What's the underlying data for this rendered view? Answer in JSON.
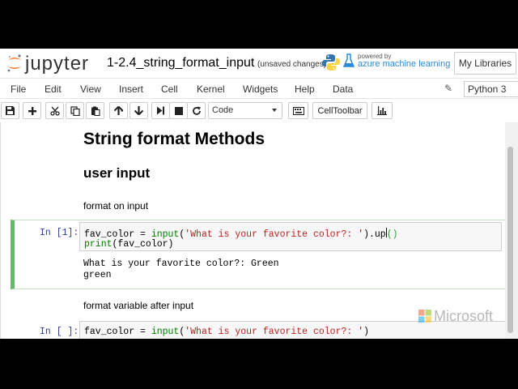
{
  "header": {
    "logo_text": "jupyter",
    "notebook_title": "1-2.4_string_format_input",
    "autosave_status": "(unsaved changes)",
    "powered_by": "powered by",
    "azure_ml": "azure machine learning",
    "my_libraries": "My Libraries"
  },
  "menu": {
    "items": [
      "File",
      "Edit",
      "View",
      "Insert",
      "Cell",
      "Kernel",
      "Widgets",
      "Help",
      "Data"
    ],
    "kernel_name": "Python 3"
  },
  "toolbar": {
    "cell_type": "Code",
    "cell_toolbar_label": "CellToolbar",
    "icons": [
      "save-icon",
      "plus-icon",
      "cut-icon",
      "copy-icon",
      "paste-icon",
      "arrow-up-icon",
      "arrow-down-icon",
      "run-icon",
      "stop-icon",
      "restart-icon",
      "keyboard-icon",
      "bar-chart-icon"
    ]
  },
  "notebook": {
    "heading1": "String format Methods",
    "heading2": "user input",
    "text1": "format on input",
    "cell1": {
      "prompt": "In [1]:",
      "code_line1": {
        "var": "fav_color = ",
        "fn": "input",
        "open": "(",
        "str": "'What is your favorite color?: '",
        "close": ")",
        "method": ".up",
        "paren": "()"
      },
      "code_line2": {
        "fn": "print",
        "rest": "(fav_color)"
      },
      "output_line1": "What is your favorite color?: Green",
      "output_line2": "green"
    },
    "text2": "format variable after input",
    "cell2": {
      "prompt": "In [ ]:",
      "code_line1": {
        "var": "fav_color = ",
        "fn": "input",
        "open": "(",
        "str": "'What is your favorite color?: '",
        "close": ")"
      }
    }
  },
  "watermark": "Microsoft",
  "colors": {
    "selected_cell_border": "#66bb6a",
    "prompt": "#303f9f",
    "builtin": "#008000",
    "string": "#ba2121",
    "azure": "#2a8bd6"
  }
}
